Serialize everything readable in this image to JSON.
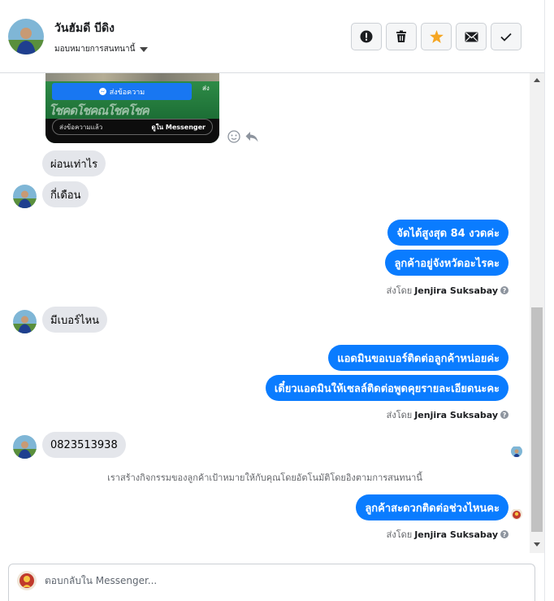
{
  "header": {
    "contact_name": "วันฮัมดี บีดิง",
    "assign_label": "มอบหมายการสนทนานี้",
    "actions": [
      "spam-report",
      "delete",
      "star",
      "mark-unread",
      "mark-done"
    ]
  },
  "ad_card": {
    "cta_label": "ส่งข้อความ",
    "side_label": "ส่ง",
    "brand_text": "โชคดโชคณโชคโชค",
    "sent_label": "ส่งข้อความแล้ว",
    "in_messenger_label": "ดูใน Messenger"
  },
  "messages": {
    "in_1": "ผ่อนเท่าไร",
    "in_2": "กี่เดือน",
    "out_1": "จัดได้สูงสุด 84 งวดค่ะ",
    "out_2": "ลูกค้าอยู่จังหวัดอะไรคะ",
    "in_3": "มีเบอร์ไหน",
    "out_3": "แอดมินขอเบอร์ติดต่อลูกค้าหน่อยค่ะ",
    "out_4": "เดี๋ยวแอดมินให้เซลล์ติดต่อพูดคุยรายละเอียดนะคะ",
    "in_4": "0823513938",
    "system_note": "เราสร้างกิจกรรมของลูกค้าเป้าหมายให้กับคุณโดยอัตโนมัติโดยอิงตามการสนทนานี้",
    "out_5": "ลูกค้าสะดวกติดต่อช่วงไหนคะ"
  },
  "sent_by": {
    "prefix": "ส่งโดย",
    "agent": "Jenjira Suksabay"
  },
  "composer": {
    "placeholder": "ตอบกลับใน Messenger..."
  },
  "colors": {
    "outgoing_bubble": "#0a7cff",
    "incoming_bubble": "#e4e6eb",
    "star": "#f5a623"
  }
}
